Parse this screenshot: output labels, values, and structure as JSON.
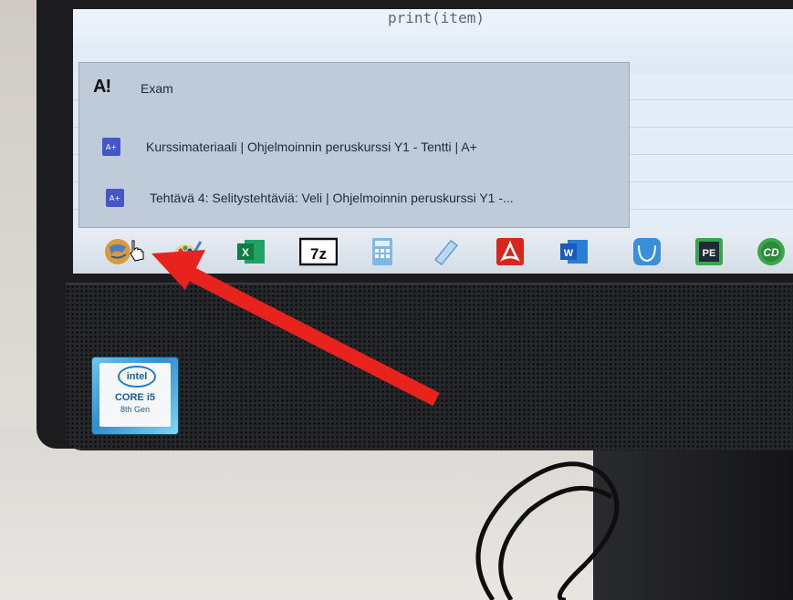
{
  "screen": {
    "code_line": "print(item)",
    "jumplist": {
      "items": [
        {
          "logo": "A!",
          "label": "Exam"
        },
        {
          "icon_text": "A+",
          "label": "Kurssimateriaali | Ohjelmoinnin peruskurssi Y1 - Tentti | A+"
        },
        {
          "icon_text": "A+",
          "label": "Tehtävä 4: Selitystehtäviä: Veli | Ohjelmoinnin peruskurssi Y1 -..."
        }
      ]
    },
    "taskbar": {
      "icons": [
        "exam-browser-icon",
        "paint-icon",
        "excel-icon",
        "7zip-icon",
        "calculator-icon",
        "notepad-icon",
        "acrobat-icon",
        "word-icon",
        "cat-app-icon",
        "pe-app-icon",
        "cd-app-icon"
      ],
      "sevenzip_text": "7z",
      "pe_text": "PE",
      "cd_text": "CD",
      "word_text": "W",
      "excel_text": "X"
    }
  },
  "badge": {
    "logo": "intel",
    "line1": "CORE i5",
    "line2": "8th Gen"
  },
  "colors": {
    "arrow": "#e8221c",
    "monitor": "#1c1c1e",
    "screen": "#e3edf7"
  }
}
